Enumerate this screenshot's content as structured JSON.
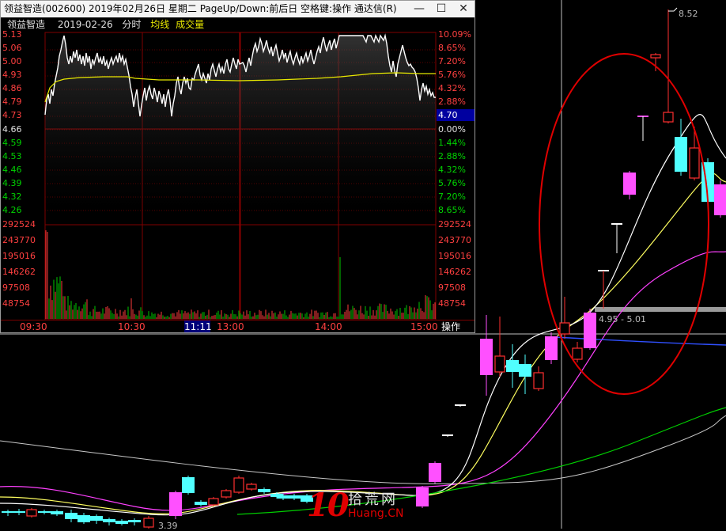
{
  "window": {
    "title": "领益智造(002600) 2019年02月26日 星期二 PageUp/Down:前后日 空格键:操作 通达信(R)",
    "min_label": "—",
    "max_label": "☐",
    "close_label": "✕"
  },
  "info_bar": {
    "stock_name": "领益智造",
    "date": "2019-02-26",
    "mode": "分时",
    "avg_line": "均线",
    "volume": "成交量"
  },
  "price_axis": [
    "5.13",
    "5.06",
    "5.00",
    "4.93",
    "4.86",
    "4.79",
    "4.73",
    "4.66",
    "4.59",
    "4.53",
    "4.46",
    "4.39",
    "4.32",
    "4.26"
  ],
  "pct_axis": [
    "10.09%",
    "8.65%",
    "7.20%",
    "5.76%",
    "4.32%",
    "2.88%",
    "",
    "0.00%",
    "1.44%",
    "2.88%",
    "4.32%",
    "5.76%",
    "7.20%",
    "8.65%"
  ],
  "current_price": "4.70",
  "volume_axis": [
    "292524",
    "243770",
    "195016",
    "146262",
    "97508",
    "48754"
  ],
  "time_axis": [
    "09:30",
    "10:30",
    "11:11",
    "13:00",
    "14:00",
    "15:00"
  ],
  "operate_label": "操作",
  "kline_annotations": {
    "high_label": "8.52",
    "range_label": "4.95 - 5.01",
    "low_label": "3.39"
  },
  "logo": {
    "number": "10",
    "cn": "拾荒网",
    "en": "Huang.CN"
  },
  "colors": {
    "up": "#ff3c3c",
    "down": "#00ffff",
    "ma5": "#ffffff",
    "ma10": "#ffff60",
    "ma20": "#ff40ff",
    "ma60": "#00d000",
    "ellipse": "#e00000"
  },
  "chart_data": {
    "type": "line",
    "title": "领益智造 2019-02-26 分时",
    "series": [
      {
        "name": "均线",
        "values": [
          4.8,
          4.86,
          4.89,
          4.9,
          4.9,
          4.9,
          4.89,
          4.88,
          4.88,
          4.88,
          4.89,
          4.9,
          4.91,
          4.92
        ]
      },
      {
        "name": "成交量",
        "values": [
          290000,
          150000,
          110000,
          80000,
          60000,
          40000,
          30000,
          48754,
          30000,
          25000,
          130000,
          40000,
          35000,
          60000
        ]
      }
    ],
    "ylim": [
      4.26,
      5.13
    ],
    "prev_close": 4.66
  }
}
